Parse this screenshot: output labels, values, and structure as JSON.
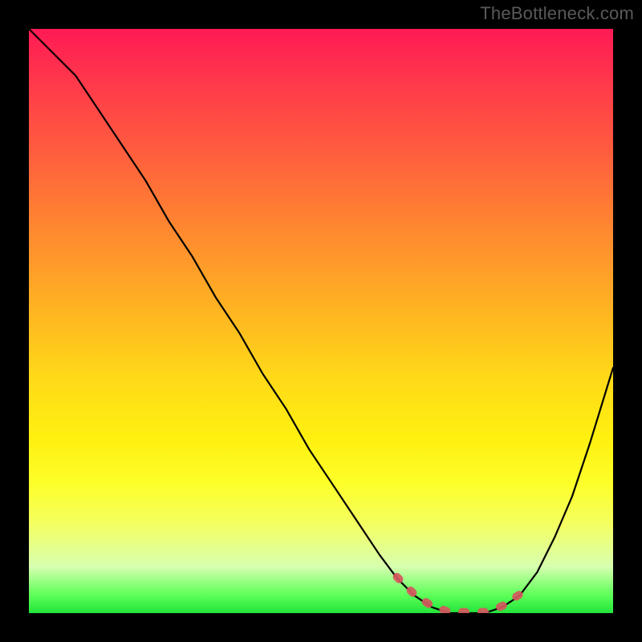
{
  "watermark": "TheBottleneck.com",
  "colors": {
    "page_bg": "#000000",
    "gradient_top": "#ff1a54",
    "gradient_bottom": "#22e43a",
    "curve_stroke": "#000000",
    "highlight_stroke": "#d6585e"
  },
  "chart_data": {
    "type": "line",
    "title": "",
    "xlabel": "",
    "ylabel": "",
    "xlim": [
      0,
      100
    ],
    "ylim": [
      0,
      100
    ],
    "series": [
      {
        "name": "bottleneck-curve",
        "x": [
          0,
          4,
          8,
          12,
          16,
          20,
          24,
          28,
          32,
          36,
          40,
          44,
          48,
          52,
          56,
          60,
          63,
          66,
          69,
          72,
          75,
          78,
          81,
          84,
          87,
          90,
          93,
          96,
          100
        ],
        "values": [
          100,
          96,
          92,
          86,
          80,
          74,
          67,
          61,
          54,
          48,
          41,
          35,
          28,
          22,
          16,
          10,
          6,
          3,
          1,
          0,
          0,
          0,
          1,
          3,
          7,
          13,
          20,
          29,
          42
        ]
      }
    ],
    "highlight": {
      "name": "optimal-range-dashed",
      "x": [
        63,
        66,
        69,
        72,
        75,
        78,
        81,
        84
      ],
      "values": [
        6,
        3,
        1,
        0,
        0,
        0,
        1,
        3
      ]
    }
  }
}
